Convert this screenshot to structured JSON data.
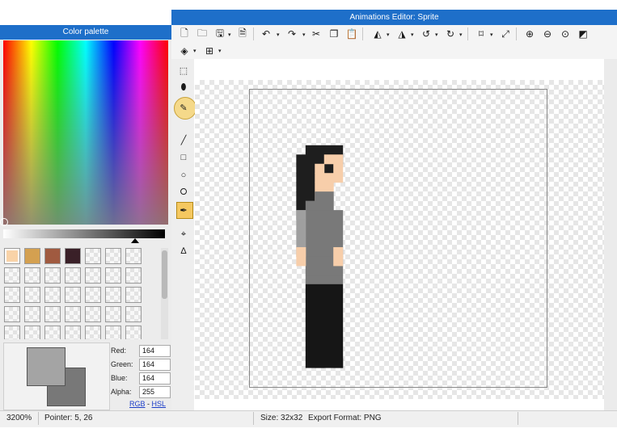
{
  "window": {
    "title": "Animations Editor: Sprite"
  },
  "palette": {
    "title": "Color palette",
    "swatches": [
      "#f9d3a8",
      "#d4a050",
      "#a05a40",
      "#3a2028"
    ],
    "selected_index": 0,
    "primary_color": "#a4a4a4",
    "secondary_color": "#787878",
    "labels": {
      "red": "Red:",
      "green": "Green:",
      "blue": "Blue:",
      "alpha": "Alpha:"
    },
    "values": {
      "red": "164",
      "green": "164",
      "blue": "164",
      "alpha": "255"
    },
    "mode_links": {
      "rgb": "RGB",
      "separator": "-",
      "hsl": "HSL"
    }
  },
  "toolbar": {
    "icons": [
      "new-file-icon",
      "open-folder-icon",
      "save-icon",
      "export-icon",
      "undo-icon",
      "redo-icon",
      "cut-icon",
      "copy-icon",
      "paste-icon",
      "flip-horizontal-icon",
      "flip-vertical-icon",
      "rotate-left-icon",
      "rotate-right-icon",
      "crop-icon",
      "resize-icon",
      "zoom-in-icon",
      "zoom-out-icon",
      "zoom-fit-icon",
      "invert-icon",
      "layers-icon",
      "grid-icon"
    ]
  },
  "tools": [
    "select-tool",
    "eraser-tool",
    "pencil-tool",
    "line-tool",
    "rectangle-tool",
    "ellipse-tool",
    "fill-tool",
    "color-picker-tool",
    "shape-point-tool",
    "polygon-tool"
  ],
  "active_tool": "color-picker-tool",
  "sprite": {
    "grid_size": 32,
    "colors": {
      "hair": "#1e1e1e",
      "skin": "#f7ceaa",
      "shirt": "#797979",
      "sleeve": "#9f9f9f",
      "pants": "#161616"
    }
  },
  "status": {
    "zoom": "3200%",
    "pointer": "Pointer: 5, 26",
    "size": "Size: 32x32",
    "export_format": "Export Format: PNG"
  }
}
